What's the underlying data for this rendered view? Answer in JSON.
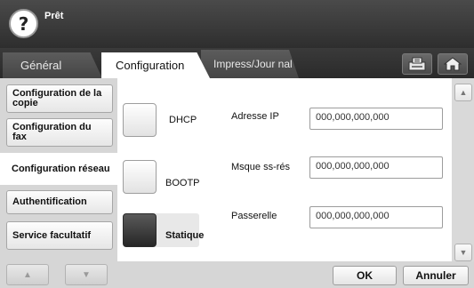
{
  "status": {
    "text": "Prêt",
    "help_icon": "?"
  },
  "tabs": [
    {
      "label": "Général",
      "selected": false
    },
    {
      "label": "Configuration",
      "selected": true
    },
    {
      "label": "Impress/Jour nal",
      "selected": false
    }
  ],
  "toolbar_icons": [
    "job-status-icon",
    "home-icon"
  ],
  "sidebar": {
    "items": [
      {
        "label": "Configuration de la copie",
        "selected": false
      },
      {
        "label": "Configuration du fax",
        "selected": false
      },
      {
        "label": "Configuration réseau",
        "selected": true
      },
      {
        "label": "Authentification",
        "selected": false
      },
      {
        "label": "Service facultatif",
        "selected": false
      }
    ],
    "up_arrow": "▲",
    "down_arrow": "▼"
  },
  "network": {
    "options": [
      {
        "label": "DHCP",
        "selected": false
      },
      {
        "label": "BOOTP",
        "selected": false
      },
      {
        "label": "Statique",
        "selected": true
      }
    ],
    "fields": [
      {
        "label": "Adresse IP",
        "value": "000,000,000,000"
      },
      {
        "label": "Msque ss-rés",
        "value": "000,000,000,000"
      },
      {
        "label": "Passerelle",
        "value": "000,000,000,000"
      }
    ]
  },
  "scroll": {
    "up": "▲",
    "down": "▼"
  },
  "buttons": {
    "ok": "OK",
    "cancel": "Annuler"
  },
  "colors": {
    "header_bg": "#2e2e2e",
    "panel_bg": "#d6d6d6",
    "selected_radio": "#262626"
  }
}
